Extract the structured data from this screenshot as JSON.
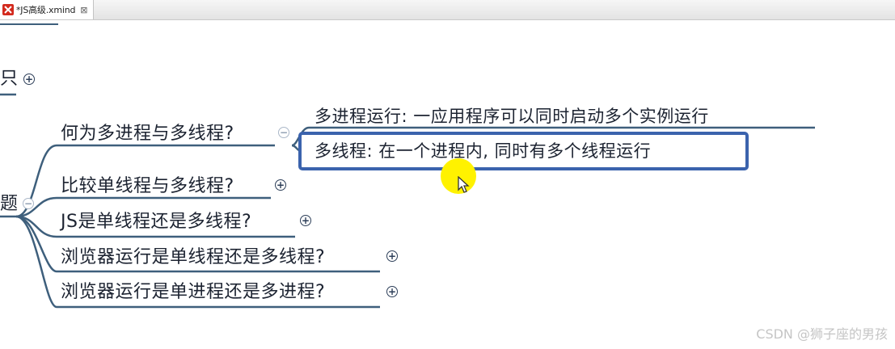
{
  "tab": {
    "title": "*JS高级.xmind",
    "close": "⊠"
  },
  "mindmap": {
    "left_fragment_top": "只",
    "left_fragment_middle": "题",
    "topics": [
      "何为多进程与多线程?",
      "比较单线程与多线程?",
      "JS是单线程还是多线程?",
      "浏览器运行是单线程还是多线程?",
      "浏览器运行是单进程还是多进程?"
    ],
    "subtopics": [
      "多进程运行: 一应用程序可以同时启动多个实例运行",
      "多线程: 在一个进程内, 同时有多个线程运行"
    ],
    "expand_symbol": "+",
    "collapse_symbol": "−"
  },
  "watermark": "CSDN @狮子座的男孩",
  "colors": {
    "branch": "#3e5f7c",
    "selection": "#3b63ad",
    "highlight": "#fff200"
  }
}
